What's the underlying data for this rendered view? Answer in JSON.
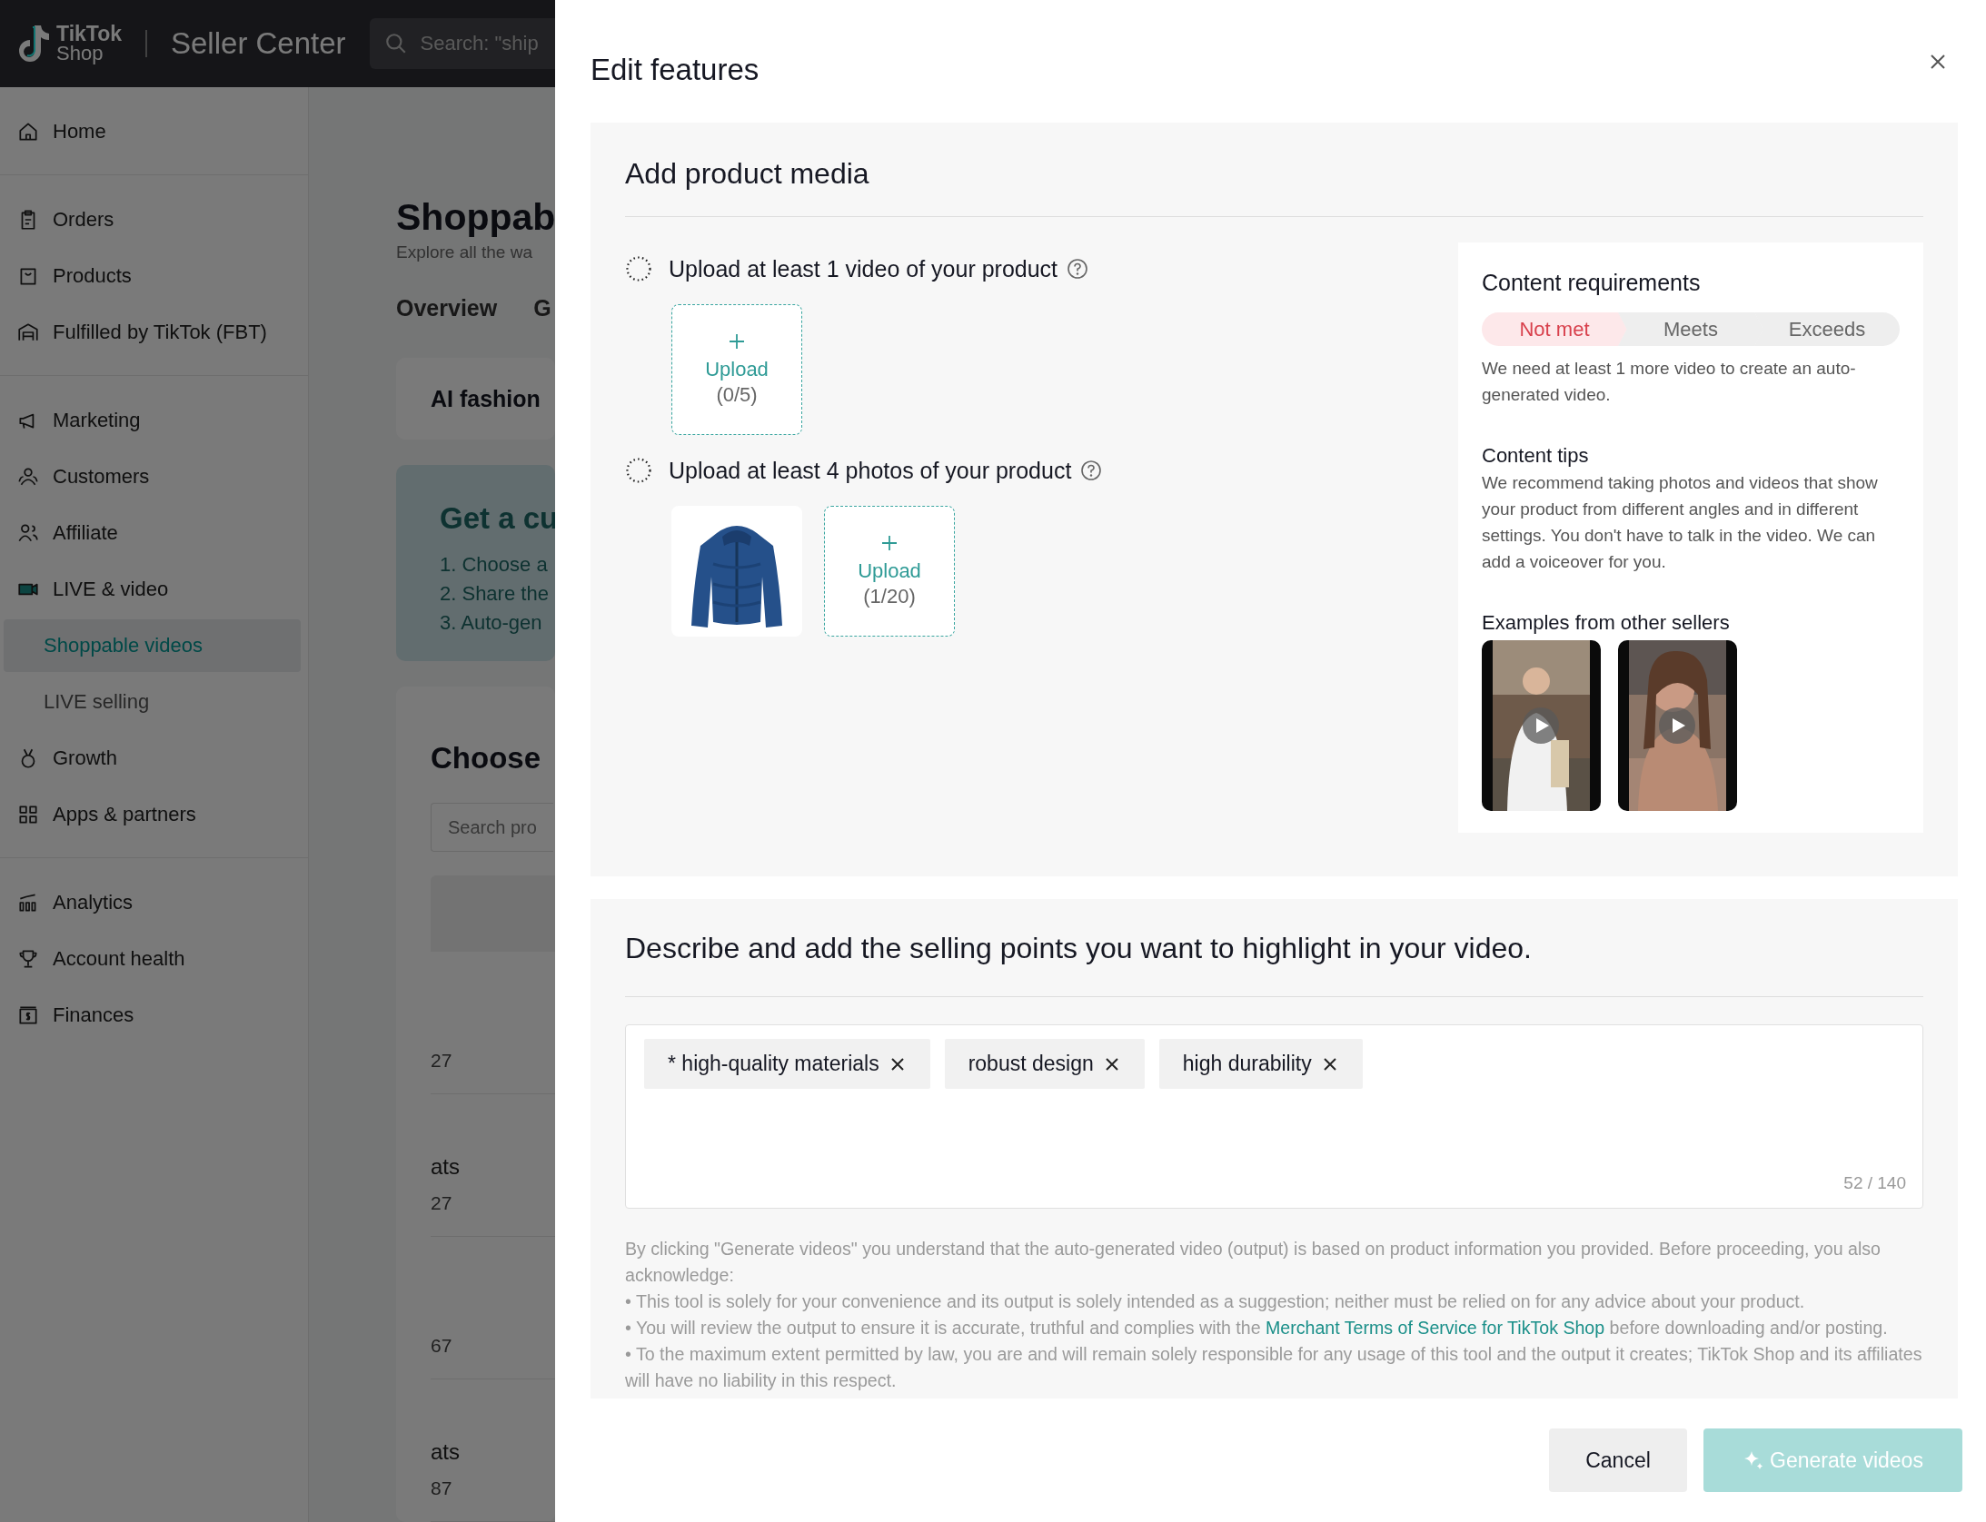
{
  "header": {
    "logo_top": "TikTok",
    "logo_bottom": "Shop",
    "product": "Seller Center",
    "search": {
      "placeholder": "Search: \"ship"
    }
  },
  "sidebar": {
    "groups": [
      {
        "items": [
          {
            "label": "Home",
            "kind": "main",
            "selected": false
          }
        ]
      },
      {
        "items": [
          {
            "label": "Orders",
            "kind": "main",
            "selected": false
          },
          {
            "label": "Products",
            "kind": "main",
            "selected": false
          },
          {
            "label": "Fulfilled by TikTok (FBT)",
            "kind": "main",
            "selected": false
          }
        ]
      },
      {
        "items": [
          {
            "label": "Marketing",
            "kind": "main",
            "selected": false
          },
          {
            "label": "Customers",
            "kind": "main",
            "selected": false
          },
          {
            "label": "Affiliate",
            "kind": "main",
            "selected": false
          },
          {
            "label": "LIVE & video",
            "kind": "main",
            "selected": false
          },
          {
            "label": "Shoppable videos",
            "kind": "sub",
            "selected": true
          },
          {
            "label": "LIVE selling",
            "kind": "sub",
            "selected": false
          },
          {
            "label": "Growth",
            "kind": "main",
            "selected": false
          },
          {
            "label": "Apps & partners",
            "kind": "main",
            "selected": false
          }
        ]
      },
      {
        "items": [
          {
            "label": "Analytics",
            "kind": "main",
            "selected": false
          },
          {
            "label": "Account health",
            "kind": "main",
            "selected": false
          },
          {
            "label": "Finances",
            "kind": "main",
            "selected": false
          }
        ]
      }
    ]
  },
  "page": {
    "title": "Shoppab",
    "subtitle": "Explore all the wa",
    "tabs": [
      "Overview",
      "G"
    ],
    "feature_card": "AI fashion",
    "promo": {
      "title": "Get a cu",
      "steps": [
        "1. Choose a",
        "2. Share the",
        "3. Auto-gen"
      ]
    },
    "chooser": {
      "title": "Choose",
      "search_placeholder": "Search pro"
    },
    "rows": [
      {
        "code": "27"
      },
      {
        "name": "ats",
        "code": "27"
      },
      {
        "code": "67"
      },
      {
        "name": "ats",
        "code": "87"
      }
    ]
  },
  "drawer": {
    "title": "Edit features",
    "media": {
      "title": "Add product media",
      "requirements": [
        {
          "title": "Upload at least 1 video of your product",
          "complete": false,
          "upload": {
            "label": "Upload",
            "count": "(0/5)"
          }
        },
        {
          "title": "Upload at least 4 photos of your product",
          "complete": false,
          "upload": {
            "label": "Upload",
            "count": "(1/20)"
          }
        }
      ],
      "card": {
        "title": "Content requirements",
        "steps": [
          {
            "label": "Not met",
            "selected": true
          },
          {
            "label": "Meets",
            "selected": false
          },
          {
            "label": "Exceeds",
            "selected": false
          }
        ],
        "status_text": "We need at least 1 more video to create an auto-generated video.",
        "tips_title": "Content tips",
        "tips_text": "We recommend taking photos and videos that show your product from different angles and in different settings. You don't have to talk in the video. We can add a voiceover for you.",
        "examples_title": "Examples from other sellers"
      }
    },
    "selling": {
      "title": "Describe and add the selling points you want to highlight in your video.",
      "tags": [
        {
          "label": "* high-quality materials"
        },
        {
          "label": "robust design"
        },
        {
          "label": "high durability"
        }
      ],
      "count": "52 / 140",
      "disclaimer": "By clicking \"Generate videos\" you understand that the auto-generated video (output) is based on product information you provided. Before proceeding, you also acknowledge:",
      "bullets": [
        {
          "before": "• This tool is solely for your convenience and its output is solely intended as a suggestion; neither must be relied on for any advice about your product."
        },
        {
          "before": "• You will review the output to ensure it is accurate, truthful and complies with the",
          "link": "Merchant Terms of Service for TikTok Shop",
          "after": "before downloading and/or posting."
        },
        {
          "before": "• To the maximum extent permitted by law, you are and will remain solely responsible for any usage of this tool and the output it creates; TikTok Shop and its affiliates will have no liability in this respect."
        }
      ]
    },
    "buttons": {
      "cancel": "Cancel",
      "generate": {
        "label": "Generate videos",
        "disabled": true
      }
    }
  }
}
